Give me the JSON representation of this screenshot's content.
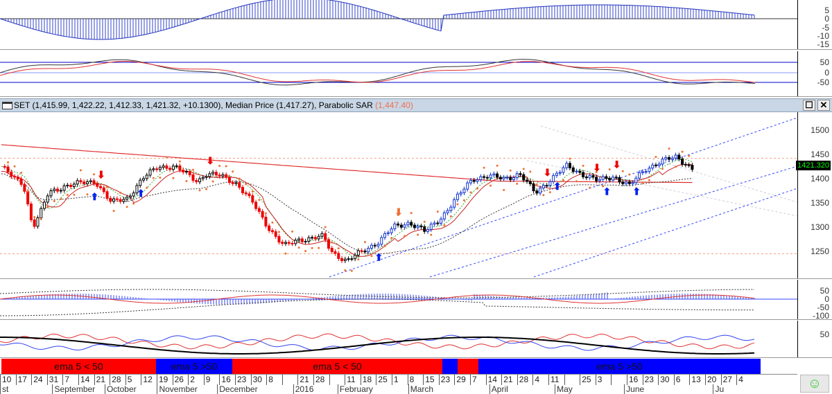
{
  "header": {
    "symbol_info": "SET (1,415.99, 1,422.22, 1,412.33, 1,421.32, +10.1300), Median Price (1,417.27), Parabolic SAR ",
    "sar_value": "(1,447.40)",
    "maximize": "☐",
    "close": "✕"
  },
  "last_price": "1421.320",
  "axes": {
    "macd": [
      "5",
      "0",
      "-5",
      "-10",
      "-15"
    ],
    "osc": [
      "50",
      "0",
      "-50"
    ],
    "price": [
      "1500",
      "1450",
      "1400",
      "1350",
      "1300",
      "1250"
    ],
    "ind4": [
      "50",
      "0",
      "-50",
      "-100"
    ],
    "ind5": [
      "50"
    ]
  },
  "bands": [
    {
      "label": "ema 5 < 50",
      "color": "#ff0000"
    },
    {
      "label": "ema 5 >50",
      "color": "#0000ff"
    },
    {
      "label": "ema 5 < 50",
      "color": "#ff0000"
    },
    {
      "label": "",
      "color": "#0000ff"
    },
    {
      "label": "",
      "color": "#ff0000"
    },
    {
      "label": "ema 5 >50",
      "color": "#0000ff"
    }
  ],
  "dates": [
    "10",
    "17",
    "24",
    "31",
    "7",
    "14",
    "21",
    "28",
    "5",
    "12",
    "19",
    "26",
    "2",
    "9",
    "16",
    "23",
    "30",
    "8",
    "",
    "21",
    "28",
    "",
    "11",
    "18",
    "25",
    "1",
    "8",
    "15",
    "23",
    "29",
    "7",
    "14",
    "21",
    "28",
    "4",
    "11",
    "",
    "25",
    "3",
    "",
    "16",
    "23",
    "30",
    "6",
    "13",
    "20",
    "27",
    "4"
  ],
  "months": [
    {
      "label": "st",
      "week": 0
    },
    {
      "label": "September",
      "week": 4
    },
    {
      "label": "October",
      "week": 8
    },
    {
      "label": "November",
      "week": 12
    },
    {
      "label": "December",
      "week": 16.6
    },
    {
      "label": "2016",
      "week": 22.4
    },
    {
      "label": "February",
      "week": 25.8
    },
    {
      "label": "March",
      "week": 31.2
    },
    {
      "label": "April",
      "week": 37.4
    },
    {
      "label": "May",
      "week": 42.4
    },
    {
      "label": "June",
      "week": 47.7
    },
    {
      "label": "Ju",
      "week": 54.5
    }
  ],
  "status_icon": "☺",
  "chart_data": {
    "type": "line",
    "title": "SET",
    "price_keypoints_week_value": [
      [
        0,
        1425
      ],
      [
        0.8,
        1400
      ],
      [
        1.4,
        1390
      ],
      [
        2,
        1300
      ],
      [
        2.5,
        1330
      ],
      [
        3,
        1370
      ],
      [
        4,
        1385
      ],
      [
        6,
        1395
      ],
      [
        7,
        1350
      ],
      [
        8,
        1360
      ],
      [
        9,
        1400
      ],
      [
        10,
        1425
      ],
      [
        11,
        1425
      ],
      [
        12.5,
        1395
      ],
      [
        13,
        1410
      ],
      [
        14,
        1405
      ],
      [
        15,
        1390
      ],
      [
        16,
        1350
      ],
      [
        17,
        1300
      ],
      [
        18,
        1260
      ],
      [
        19,
        1275
      ],
      [
        20.5,
        1280
      ],
      [
        21,
        1250
      ],
      [
        22,
        1230
      ],
      [
        23,
        1250
      ],
      [
        24,
        1270
      ],
      [
        25,
        1300
      ],
      [
        26,
        1310
      ],
      [
        27,
        1290
      ],
      [
        28,
        1320
      ],
      [
        29,
        1360
      ],
      [
        30,
        1400
      ],
      [
        31,
        1405
      ],
      [
        32,
        1400
      ],
      [
        33,
        1410
      ],
      [
        34,
        1370
      ],
      [
        35,
        1400
      ],
      [
        36,
        1425
      ],
      [
        37,
        1410
      ],
      [
        38,
        1395
      ],
      [
        39,
        1405
      ],
      [
        40,
        1385
      ],
      [
        41,
        1420
      ],
      [
        42,
        1435
      ],
      [
        43,
        1445
      ],
      [
        44,
        1421
      ]
    ],
    "ylim": [
      1200,
      1530
    ],
    "resistance": 1442,
    "support": 1245
  }
}
